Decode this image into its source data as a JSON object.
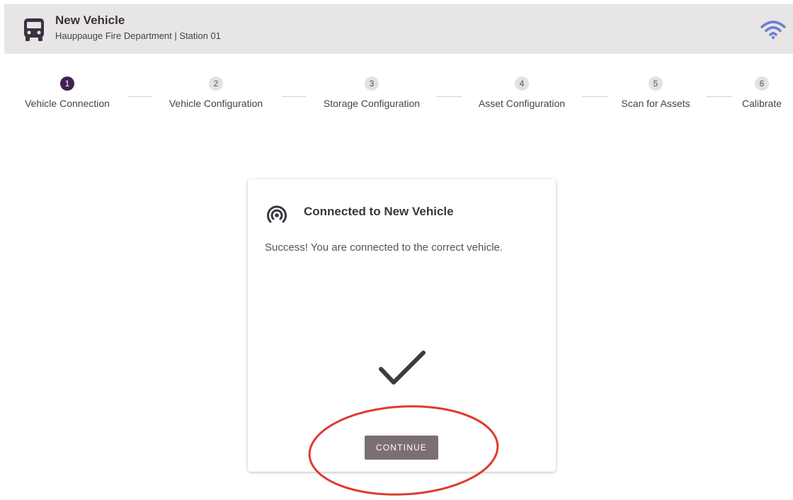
{
  "header": {
    "title": "New Vehicle",
    "subtitle": "Hauppauge Fire Department | Station 01",
    "icon": "bus-icon",
    "status_icon": "wifi-icon"
  },
  "stepper": {
    "active_step": 1,
    "steps": [
      {
        "number": "1",
        "label": "Vehicle Connection"
      },
      {
        "number": "2",
        "label": "Vehicle Configuration"
      },
      {
        "number": "3",
        "label": "Storage Configuration"
      },
      {
        "number": "4",
        "label": "Asset Configuration"
      },
      {
        "number": "5",
        "label": "Scan for Assets"
      },
      {
        "number": "6",
        "label": "Calibrate"
      }
    ]
  },
  "card": {
    "icon": "signal-icon",
    "title": "Connected to New Vehicle",
    "message": "Success! You are connected to the correct vehicle.",
    "status_icon": "checkmark-icon",
    "continue_label": "CONTINUE"
  },
  "colors": {
    "header_bg": "#e7e5e5",
    "active_step": "#41234f",
    "wifi": "#6b7fd6",
    "button_bg": "#7b7071",
    "annotation": "#e03a2f"
  }
}
